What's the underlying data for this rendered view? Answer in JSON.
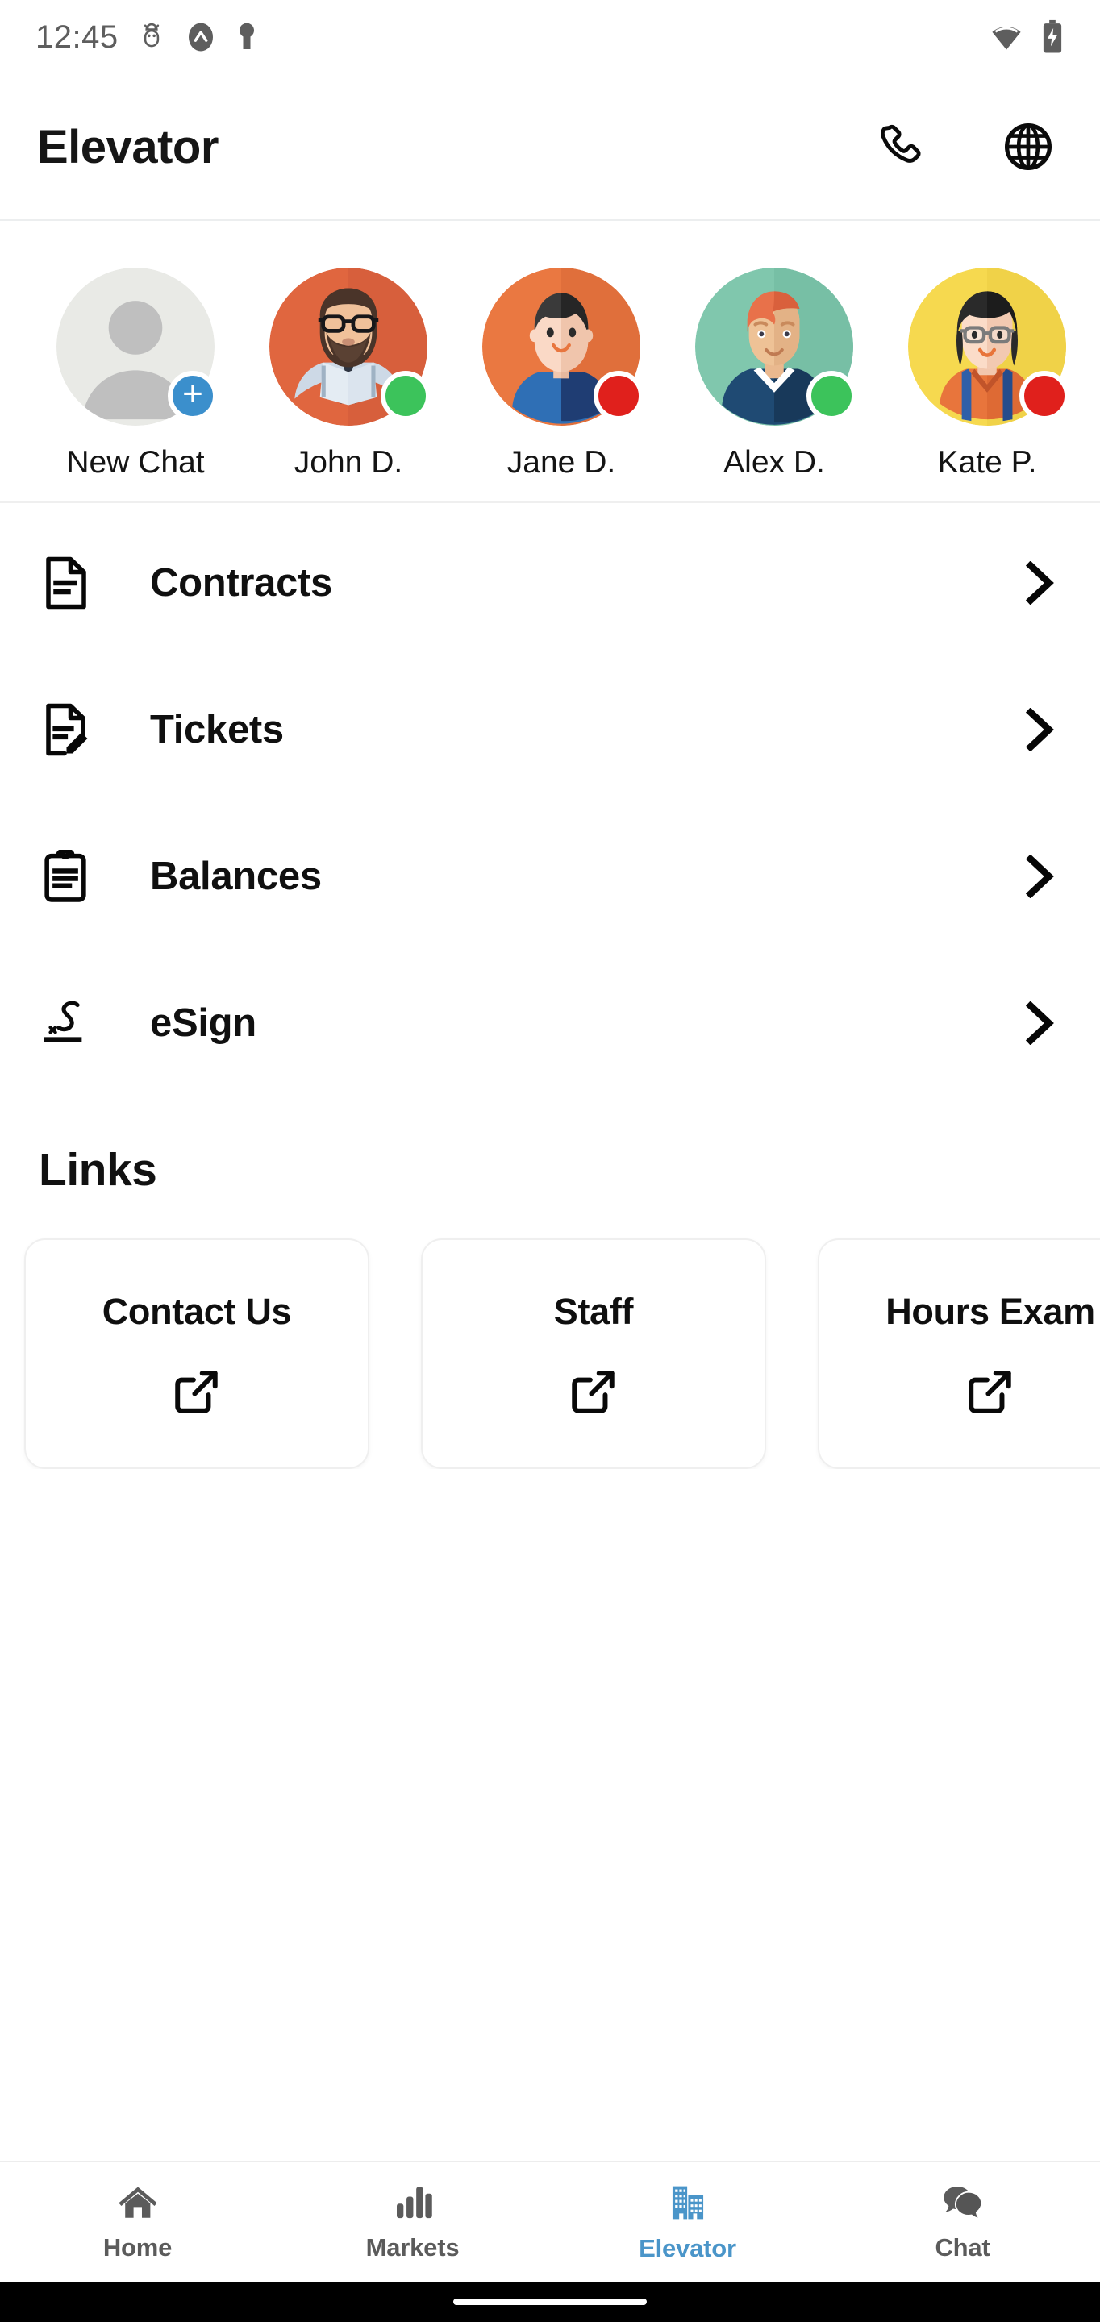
{
  "status_bar": {
    "time": "12:45",
    "left_icons": [
      "android-debug-icon",
      "app-notification-icon",
      "vpn-key-icon"
    ],
    "right_icons": [
      "wifi-icon",
      "battery-charging-icon"
    ]
  },
  "header": {
    "title": "Elevator",
    "actions": [
      {
        "name": "phone-icon",
        "label": "Call"
      },
      {
        "name": "globe-icon",
        "label": "Web"
      }
    ]
  },
  "contacts": {
    "items": [
      {
        "name": "New Chat",
        "badge": "add",
        "avatar": "placeholder",
        "bg": "#e9eae6"
      },
      {
        "name": "John D.",
        "badge": "online",
        "avatar": "man-beard-glasses",
        "bg": "#e0663f"
      },
      {
        "name": "Jane D.",
        "badge": "busy",
        "avatar": "woman-dark-hair",
        "bg": "#ea7841"
      },
      {
        "name": "Alex D.",
        "badge": "online",
        "avatar": "man-red-hair",
        "bg": "#80c7ad"
      },
      {
        "name": "Kate P.",
        "badge": "busy",
        "avatar": "woman-glasses",
        "bg": "#f5d council"
      },
      {
        "name": "",
        "badge": "none",
        "avatar": "partial-blue",
        "bg": "#8ab6dd"
      }
    ]
  },
  "menu": {
    "items": [
      {
        "label": "Contracts",
        "icon": "document-icon",
        "chevron": "chevron-right-icon"
      },
      {
        "label": "Tickets",
        "icon": "document-edit-icon",
        "chevron": "chevron-right-icon"
      },
      {
        "label": "Balances",
        "icon": "clipboard-icon",
        "chevron": "chevron-right-icon"
      },
      {
        "label": "eSign",
        "icon": "signature-icon",
        "chevron": "chevron-right-icon"
      }
    ]
  },
  "links": {
    "heading": "Links",
    "cards": [
      {
        "title": "Contact Us",
        "icon": "external-link-icon"
      },
      {
        "title": "Staff",
        "icon": "external-link-icon"
      },
      {
        "title": "Hours Exam",
        "icon": "external-link-icon"
      }
    ]
  },
  "tabbar": {
    "active": "Elevator",
    "accent": "#4a95c9",
    "inactive_color": "#5b5b5b",
    "items": [
      {
        "label": "Home",
        "icon": "home-icon"
      },
      {
        "label": "Markets",
        "icon": "bar-chart-icon"
      },
      {
        "label": "Elevator",
        "icon": "building-icon"
      },
      {
        "label": "Chat",
        "icon": "chat-bubbles-icon"
      }
    ]
  }
}
